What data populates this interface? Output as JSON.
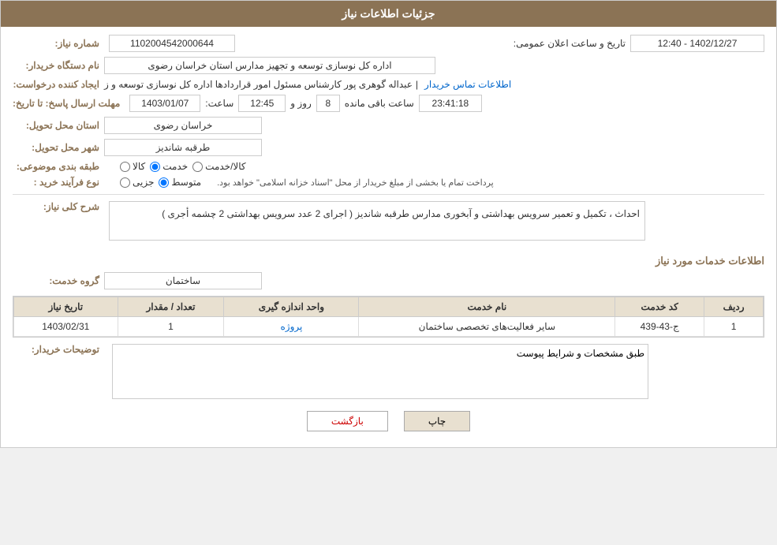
{
  "header": {
    "title": "جزئیات اطلاعات نیاز"
  },
  "fields": {
    "need_number_label": "شماره نیاز:",
    "need_number_value": "1102004542000644",
    "buyer_label": "نام دستگاه خریدار:",
    "buyer_value": "اداره کل نوسازی  توسعه و تجهیز مدارس استان خراسان رضوی",
    "creator_label": "ایجاد کننده درخواست:",
    "creator_value": "عبداله گوهری پور کارشناس مسئول امور قراردادها  اداره کل نوسازی  توسعه و ز",
    "contact_link": "اطلاعات تماس خریدار",
    "deadline_label": "مهلت ارسال پاسخ: تا تاریخ:",
    "deadline_date": "1403/01/07",
    "deadline_time_label": "ساعت:",
    "deadline_time": "12:45",
    "deadline_days_label": "روز و",
    "deadline_days": "8",
    "deadline_remaining_label": "ساعت باقی مانده",
    "deadline_remaining": "23:41:18",
    "announce_label": "تاریخ و ساعت اعلان عمومی:",
    "announce_value": "1402/12/27 - 12:40",
    "province_label": "استان محل تحویل:",
    "province_value": "خراسان رضوی",
    "city_label": "شهر محل تحویل:",
    "city_value": "طرقبه شاندیز",
    "classification_label": "طبقه بندی موضوعی:",
    "classification_options": [
      "کالا",
      "خدمت",
      "کالا/خدمت"
    ],
    "classification_selected": "خدمت",
    "purchase_type_label": "نوع فرآیند خرید :",
    "purchase_type_options": [
      "جزیی",
      "متوسط"
    ],
    "purchase_type_selected": "متوسط",
    "purchase_type_note": "پرداخت تمام یا بخشی از مبلغ خریدار از محل \"اسناد خزانه اسلامی\" خواهد بود.",
    "description_label": "شرح کلی نیاز:",
    "description_value": "احداث ، تکمیل و تعمیر سرویس بهداشتی و آبخوری مدارس طرقبه شاندیز ( اجرای 2 عدد سرویس بهداشتی 2 چشمه أجری )",
    "services_title": "اطلاعات خدمات مورد نیاز",
    "service_group_label": "گروه خدمت:",
    "service_group_value": "ساختمان",
    "table": {
      "headers": [
        "ردیف",
        "کد خدمت",
        "نام خدمت",
        "واحد اندازه گیری",
        "تعداد / مقدار",
        "تاریخ نیاز"
      ],
      "rows": [
        {
          "row": "1",
          "code": "ج-43-439",
          "name": "سایر فعالیت‌های تخصصی ساختمان",
          "unit": "پروژه",
          "quantity": "1",
          "date": "1403/02/31"
        }
      ]
    },
    "notes_label": "توضیحات خریدار:",
    "notes_value": "طبق مشخصات و شرایط پیوست",
    "btn_print": "چاپ",
    "btn_back": "بازگشت"
  }
}
